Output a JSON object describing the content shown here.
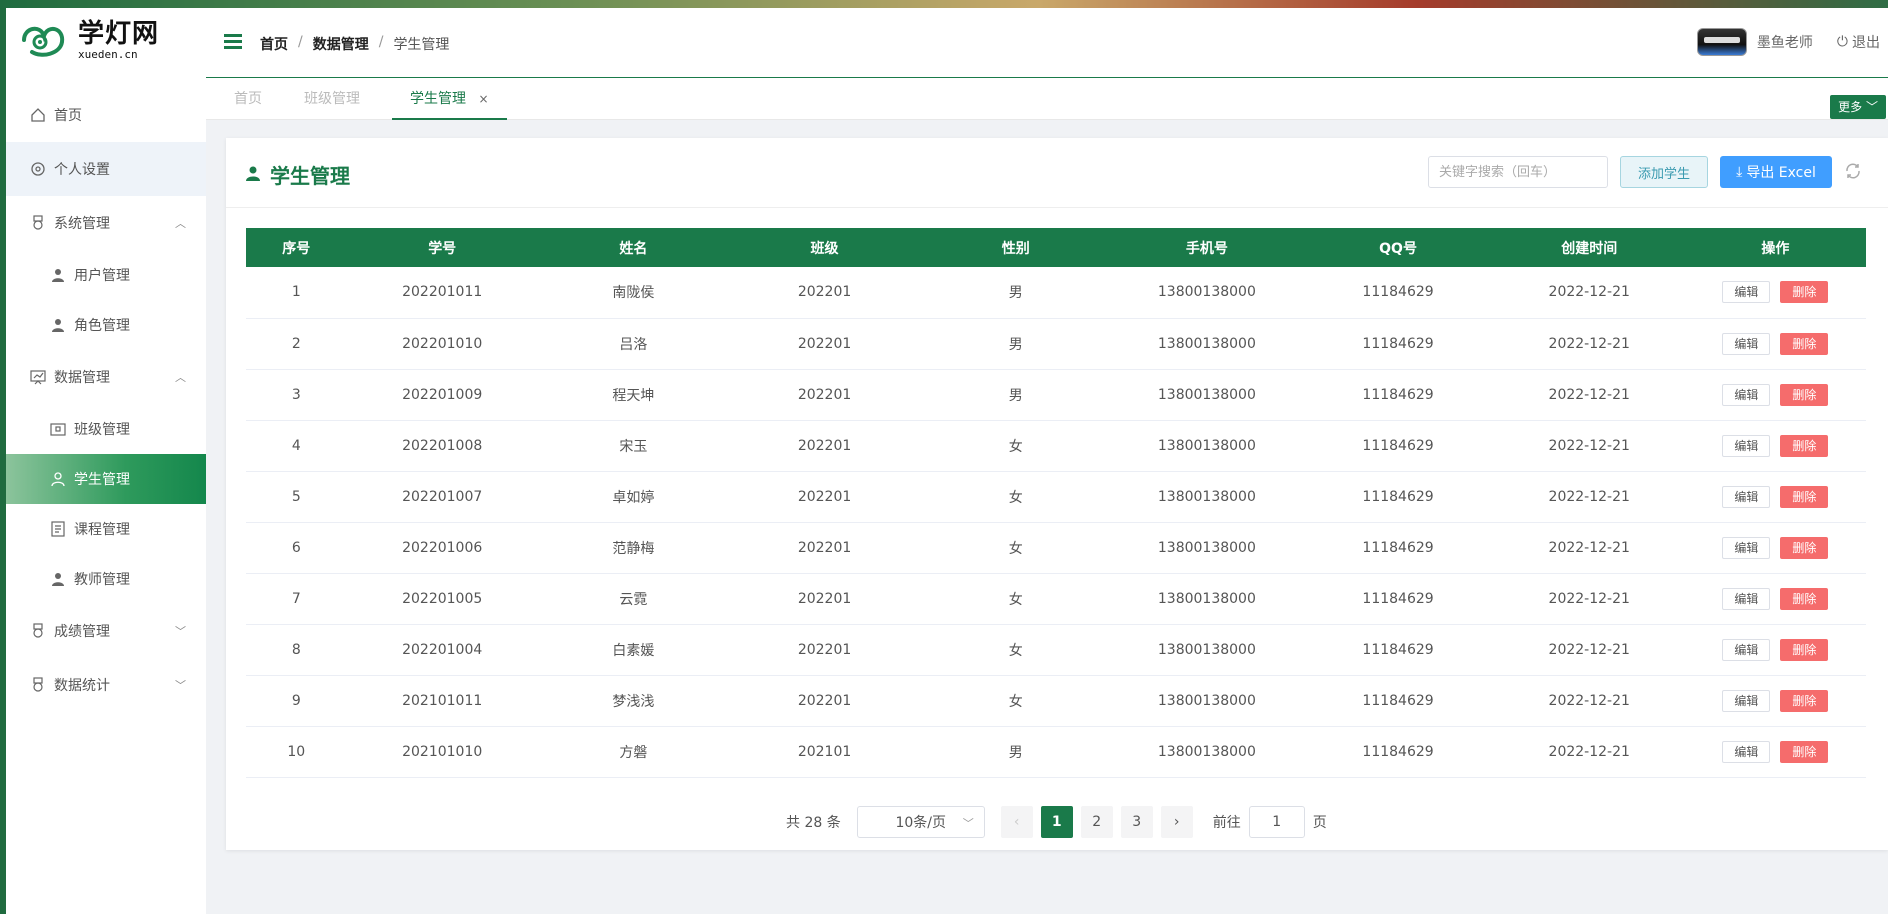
{
  "brand": {
    "title": "学灯网",
    "subtitle": "xueden.cn"
  },
  "sidebar": {
    "items": [
      {
        "label": "首页",
        "icon": "home-icon"
      },
      {
        "label": "个人设置",
        "icon": "settings-icon"
      },
      {
        "label": "系统管理",
        "icon": "medal-icon"
      },
      {
        "label": "用户管理",
        "icon": "user-icon"
      },
      {
        "label": "角色管理",
        "icon": "user-icon"
      },
      {
        "label": "数据管理",
        "icon": "chart-icon"
      },
      {
        "label": "班级管理",
        "icon": "class-icon"
      },
      {
        "label": "学生管理",
        "icon": "user-outline-icon"
      },
      {
        "label": "课程管理",
        "icon": "document-icon"
      },
      {
        "label": "教师管理",
        "icon": "user-icon"
      },
      {
        "label": "成绩管理",
        "icon": "medal-icon"
      },
      {
        "label": "数据统计",
        "icon": "medal-icon"
      }
    ]
  },
  "header": {
    "breadcrumb": [
      "首页",
      "数据管理",
      "学生管理"
    ],
    "user_name": "墨鱼老师",
    "logout_label": "退出"
  },
  "tabs": [
    {
      "label": "首页"
    },
    {
      "label": "班级管理"
    },
    {
      "label": "学生管理",
      "close": "×"
    }
  ],
  "more_label": "更多",
  "page": {
    "title": "学生管理",
    "search_placeholder": "关键字搜索（回车）",
    "add_label": "添加学生",
    "export_label": "导出 Excel"
  },
  "table": {
    "columns": [
      "序号",
      "学号",
      "姓名",
      "班级",
      "性别",
      "手机号",
      "QQ号",
      "创建时间",
      "操作"
    ],
    "edit_label": "编辑",
    "delete_label": "删除",
    "rows": [
      [
        "1",
        "202201011",
        "南陇侯",
        "202201",
        "男",
        "13800138000",
        "11184629",
        "2022-12-21"
      ],
      [
        "2",
        "202201010",
        "吕洛",
        "202201",
        "男",
        "13800138000",
        "11184629",
        "2022-12-21"
      ],
      [
        "3",
        "202201009",
        "程天坤",
        "202201",
        "男",
        "13800138000",
        "11184629",
        "2022-12-21"
      ],
      [
        "4",
        "202201008",
        "宋玉",
        "202201",
        "女",
        "13800138000",
        "11184629",
        "2022-12-21"
      ],
      [
        "5",
        "202201007",
        "卓如婷",
        "202201",
        "女",
        "13800138000",
        "11184629",
        "2022-12-21"
      ],
      [
        "6",
        "202201006",
        "范静梅",
        "202201",
        "女",
        "13800138000",
        "11184629",
        "2022-12-21"
      ],
      [
        "7",
        "202201005",
        "云霓",
        "202201",
        "女",
        "13800138000",
        "11184629",
        "2022-12-21"
      ],
      [
        "8",
        "202201004",
        "白素媛",
        "202201",
        "女",
        "13800138000",
        "11184629",
        "2022-12-21"
      ],
      [
        "9",
        "202101011",
        "梦浅浅",
        "202201",
        "女",
        "13800138000",
        "11184629",
        "2022-12-21"
      ],
      [
        "10",
        "202101010",
        "方磐",
        "202101",
        "男",
        "13800138000",
        "11184629",
        "2022-12-21"
      ]
    ]
  },
  "pagination": {
    "total_text": "共 28 条",
    "page_size": "10条/页",
    "pages": [
      "1",
      "2",
      "3"
    ],
    "current": "1",
    "goto_label": "前往",
    "goto_value": "1",
    "page_suffix": "页"
  },
  "colors": {
    "primary": "#1a7a4a",
    "danger": "#f56c6c",
    "export": "#409eff"
  }
}
